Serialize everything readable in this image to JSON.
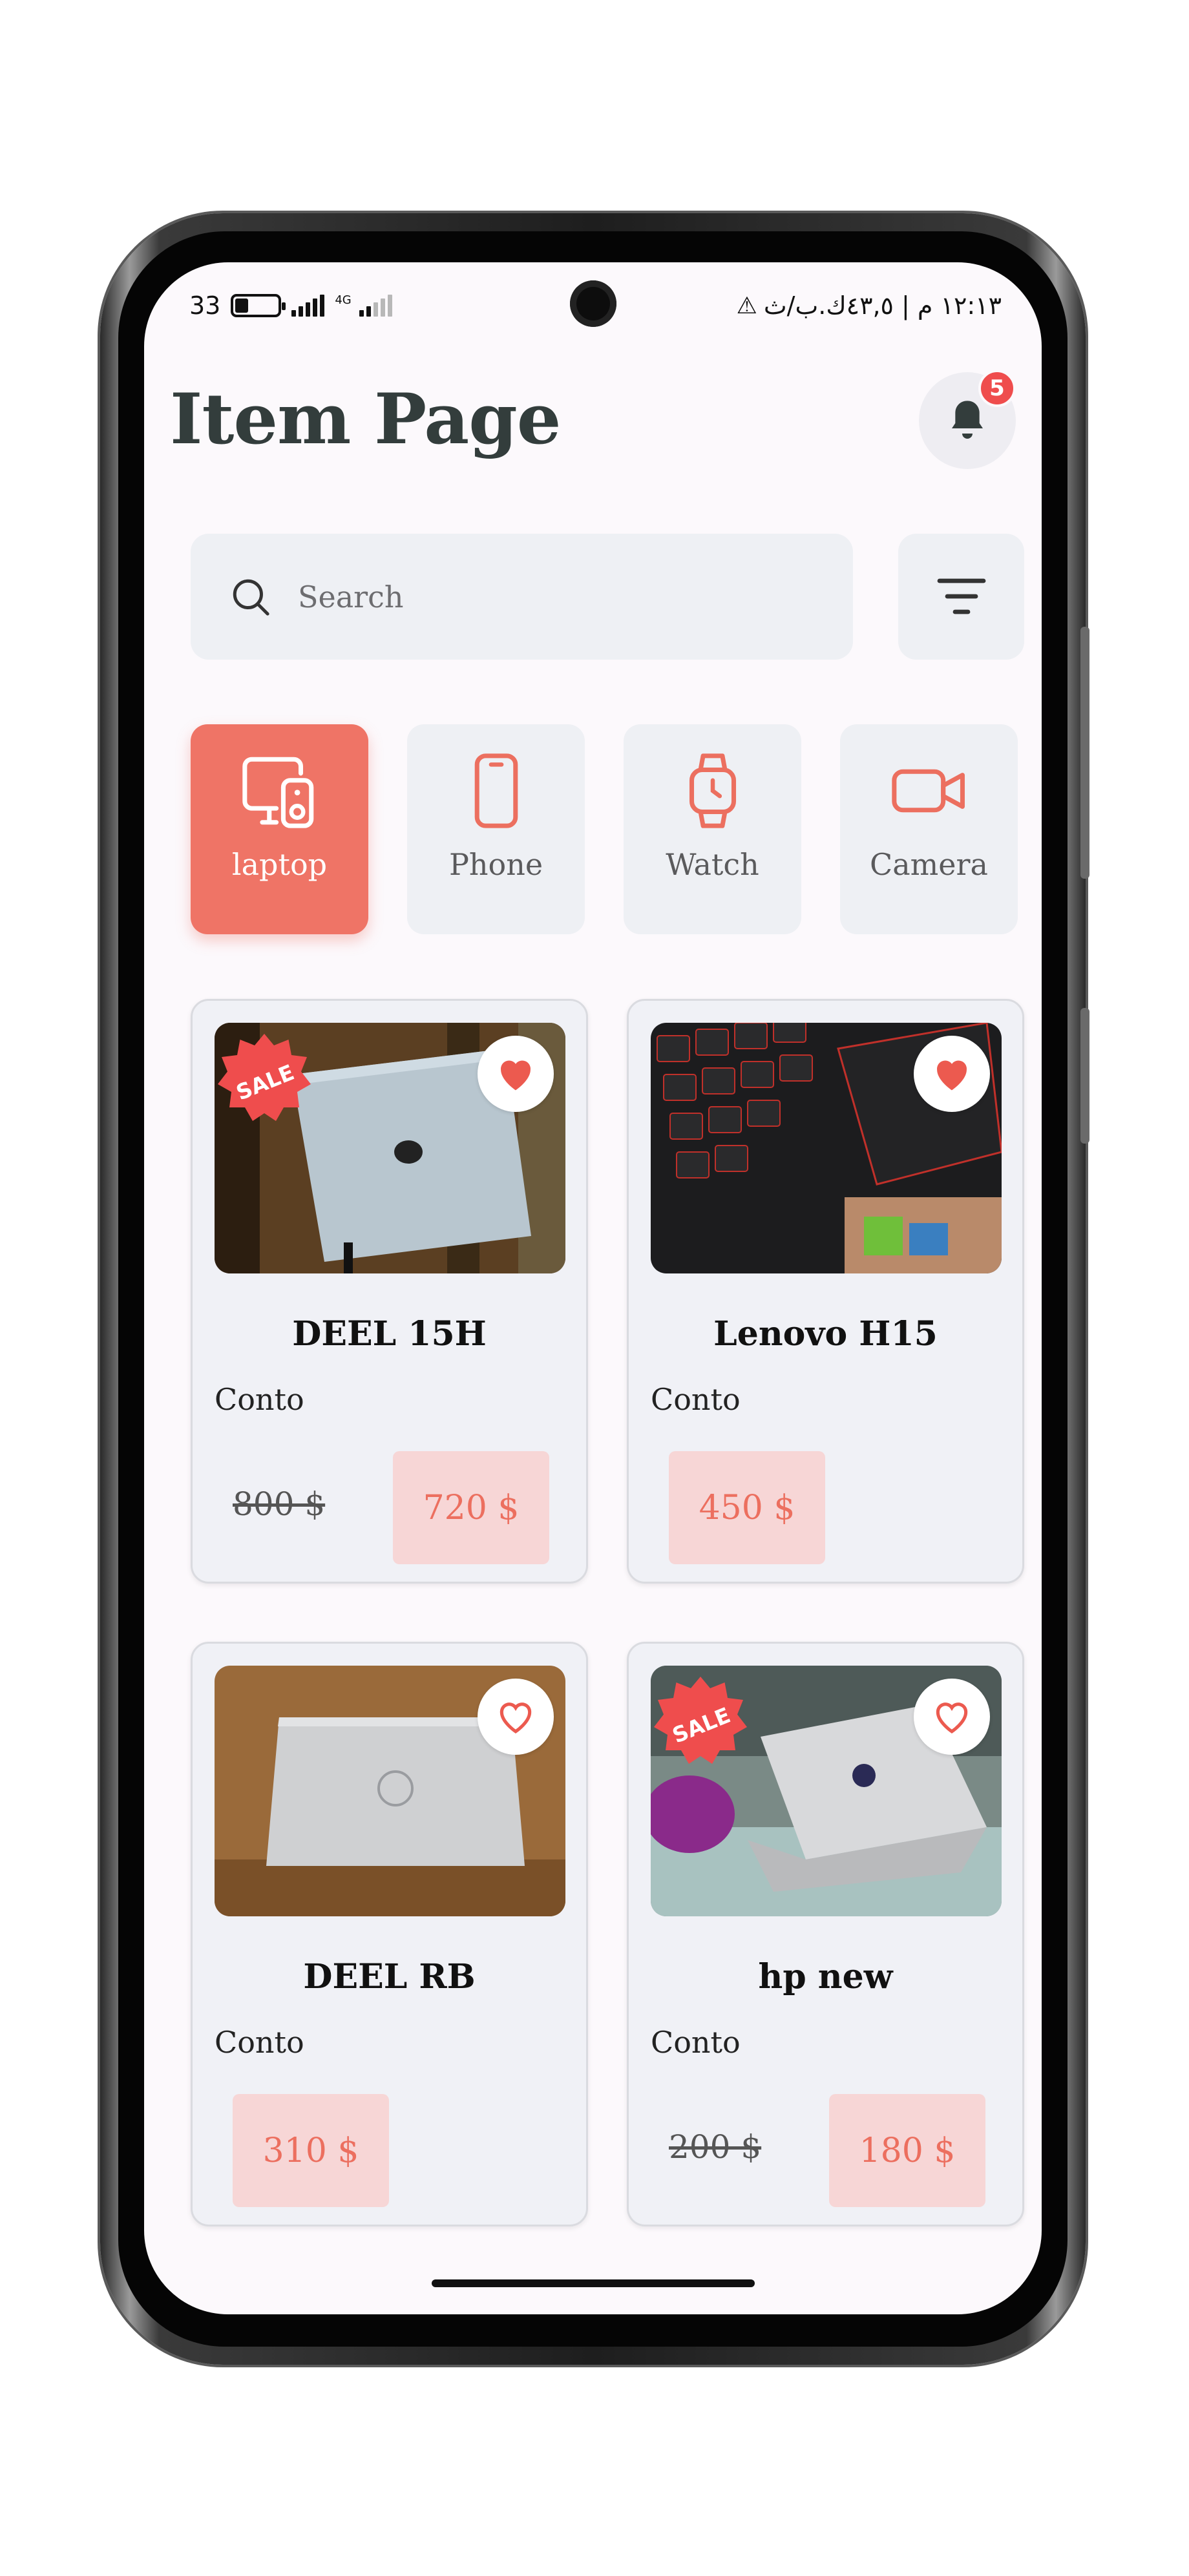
{
  "status_bar": {
    "battery_text": "33",
    "network_label": "4G",
    "right_text": "١٢:١٣ م | ٤٣,٥ك.ب/ث",
    "warning_icon": "warning-icon"
  },
  "header": {
    "title": "Item Page",
    "notification_count": "5"
  },
  "search": {
    "placeholder": "Search"
  },
  "categories": [
    {
      "label": "laptop",
      "icon": "devices-icon",
      "active": true
    },
    {
      "label": "Phone",
      "icon": "phone-icon",
      "active": false
    },
    {
      "label": "Watch",
      "icon": "watch-icon",
      "active": false
    },
    {
      "label": "Camera",
      "icon": "video-camera-icon",
      "active": false
    }
  ],
  "products": [
    {
      "name": "DEEL 15H",
      "subtitle": "Conto",
      "old_price": "800 $",
      "price": "720 $",
      "sale": true,
      "sale_label": "SALE",
      "favorite": true
    },
    {
      "name": "Lenovo H15",
      "subtitle": "Conto",
      "old_price": "",
      "price": "450 $",
      "sale": false,
      "favorite": true
    },
    {
      "name": "DEEL RB",
      "subtitle": "Conto",
      "old_price": "",
      "price": "310 $",
      "sale": false,
      "favorite": false
    },
    {
      "name": "hp new",
      "subtitle": "Conto",
      "old_price": "200 $",
      "price": "180 $",
      "sale": true,
      "sale_label": "SALE",
      "favorite": false
    }
  ],
  "colors": {
    "accent": "#ef7466",
    "price_bg": "#f7d6d6",
    "price_text": "#ec6f5f",
    "badge": "#ef4d4d",
    "title": "#333d3c"
  }
}
